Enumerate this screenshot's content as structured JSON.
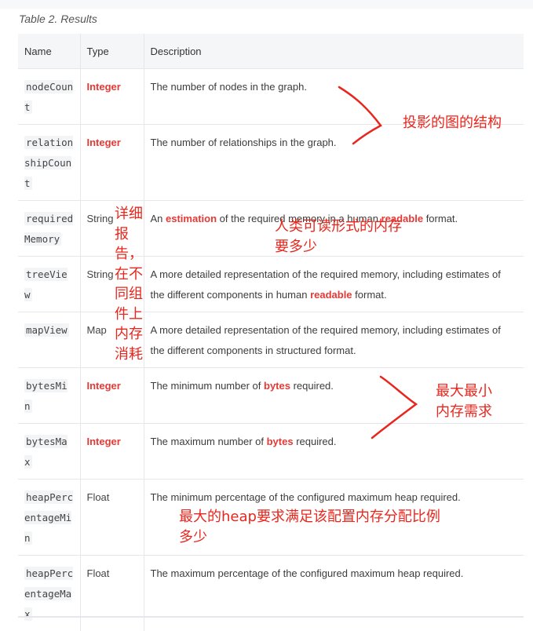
{
  "caption": "Table 2. Results",
  "columns": [
    "Name",
    "Type",
    "Description"
  ],
  "rows": [
    {
      "name": "nodeCount",
      "type": "Integer",
      "desc": [
        {
          "t": "The number of nodes in the graph."
        }
      ]
    },
    {
      "name": "relationshipCount",
      "type": "Integer",
      "desc": [
        {
          "t": "The number of relationships in the graph."
        }
      ]
    },
    {
      "name": "requiredMemory",
      "type": "String",
      "desc": [
        {
          "t": "An "
        },
        {
          "t": "estimation",
          "h": true
        },
        {
          "t": " of the required memory in a human "
        },
        {
          "t": "readable",
          "h": true
        },
        {
          "t": " format."
        }
      ]
    },
    {
      "name": "treeView",
      "type": "String",
      "desc": [
        {
          "t": "A more detailed representation of the required memory, including estimates of the different components in human "
        },
        {
          "t": "readable",
          "h": true
        },
        {
          "t": " format."
        }
      ]
    },
    {
      "name": "mapView",
      "type": "Map",
      "desc": [
        {
          "t": "A more detailed representation of the required memory, including estimates of the different components in structured format."
        }
      ]
    },
    {
      "name": "bytesMin",
      "type": "Integer",
      "desc": [
        {
          "t": "The minimum number of "
        },
        {
          "t": "bytes",
          "h": true
        },
        {
          "t": " required."
        }
      ]
    },
    {
      "name": "bytesMax",
      "type": "Integer",
      "desc": [
        {
          "t": "The maximum number of "
        },
        {
          "t": "bytes",
          "h": true
        },
        {
          "t": " required."
        }
      ]
    },
    {
      "name": "heapPercentageMin",
      "type": "Float",
      "desc": [
        {
          "t": "The minimum percentage of the configured maximum heap required."
        }
      ]
    },
    {
      "name": "heapPercentageMax",
      "type": "Float",
      "desc": [
        {
          "t": "The maximum percentage of the configured maximum heap required."
        }
      ]
    }
  ],
  "annotations": {
    "graph_structure": "投影的图的结构",
    "human_readable_1": "人类可读形式的内存",
    "human_readable_2": "要多少",
    "detailed_report": "详细报告，在不同组件上内存消耗",
    "min_max_memory_1": "最大最小",
    "min_max_memory_2": "内存需求",
    "heap_1": "最大的heap要求满足该配置内存分配比例",
    "heap_2": "多少"
  },
  "colors": {
    "highlight": "#e53935",
    "annotation": "#e8261d"
  }
}
